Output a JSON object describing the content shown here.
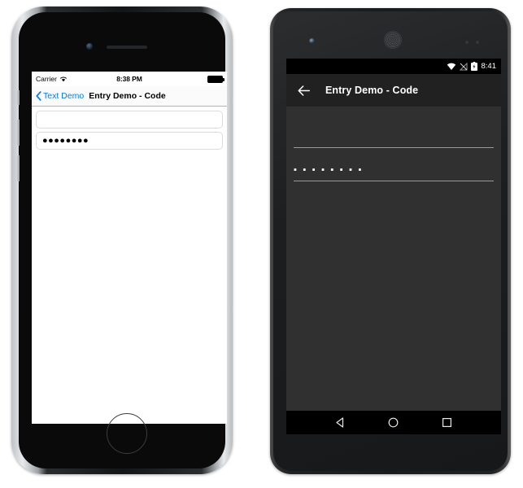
{
  "ios": {
    "device": "iphone",
    "status_bar": {
      "carrier": "Carrier",
      "wifi_icon": "wifi-icon",
      "time": "8:38 PM",
      "battery_icon": "battery-full-icon"
    },
    "nav_bar": {
      "back_icon": "chevron-left-icon",
      "back_label": "Text Demo",
      "title": "Entry Demo - Code",
      "accent_color": "#007AFF"
    },
    "entries": [
      {
        "name": "entry-plain",
        "value": "",
        "placeholder": ""
      },
      {
        "name": "entry-password",
        "value": "●●●●●●●●",
        "placeholder": ""
      }
    ],
    "hardware": {
      "camera_icon": "front-camera-icon",
      "speaker_icon": "earpiece-speaker-icon",
      "home_button_icon": "home-button-icon"
    }
  },
  "android": {
    "device": "nexus",
    "status_bar": {
      "wifi_icon": "wifi-icon",
      "signal_icon": "signal-off-icon",
      "battery_icon": "battery-charging-icon",
      "time": "8:41"
    },
    "app_bar": {
      "back_icon": "arrow-left-icon",
      "title": "Entry Demo - Code",
      "background_color": "#212121"
    },
    "entries": [
      {
        "name": "entry-plain",
        "value": "",
        "placeholder": ""
      },
      {
        "name": "entry-password",
        "value": "▪ ▪ ▪ ▪ ▪ ▪ ▪ ▪",
        "placeholder": ""
      }
    ],
    "nav_bar": {
      "back_icon": "nav-back-triangle-icon",
      "home_icon": "nav-home-circle-icon",
      "recents_icon": "nav-recents-square-icon"
    },
    "hardware": {
      "camera_icon": "front-camera-icon",
      "speaker_icon": "earpiece-speaker-icon",
      "sensor_icon": "proximity-sensor-icon"
    },
    "colors": {
      "content_background": "#303030",
      "app_bar": "#212121",
      "status_bar": "#000000"
    }
  }
}
